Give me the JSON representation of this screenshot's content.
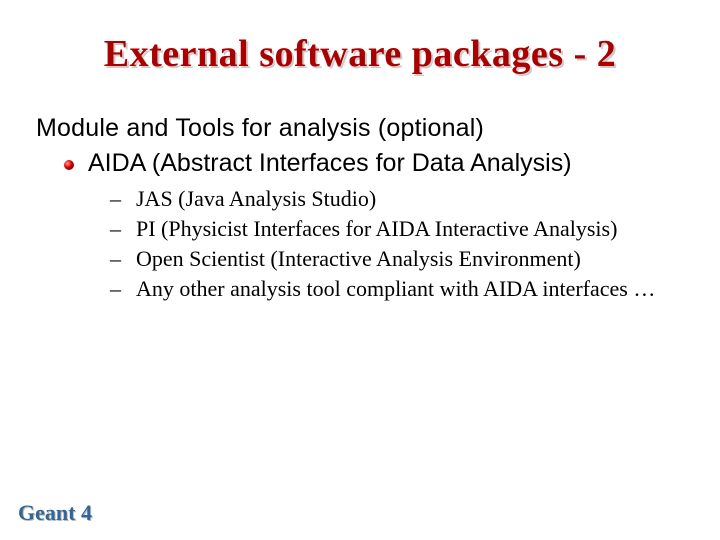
{
  "title": "External software packages - 2",
  "subhead": "Module and Tools for analysis (optional)",
  "bullet": "AIDA (Abstract Interfaces for Data Analysis)",
  "subitems": [
    "JAS (Java Analysis Studio)",
    "PI (Physicist Interfaces for AIDA Interactive Analysis)",
    "Open Scientist (Interactive Analysis Environment)",
    "Any other analysis tool compliant with AIDA interfaces …"
  ],
  "footer": "Geant 4"
}
